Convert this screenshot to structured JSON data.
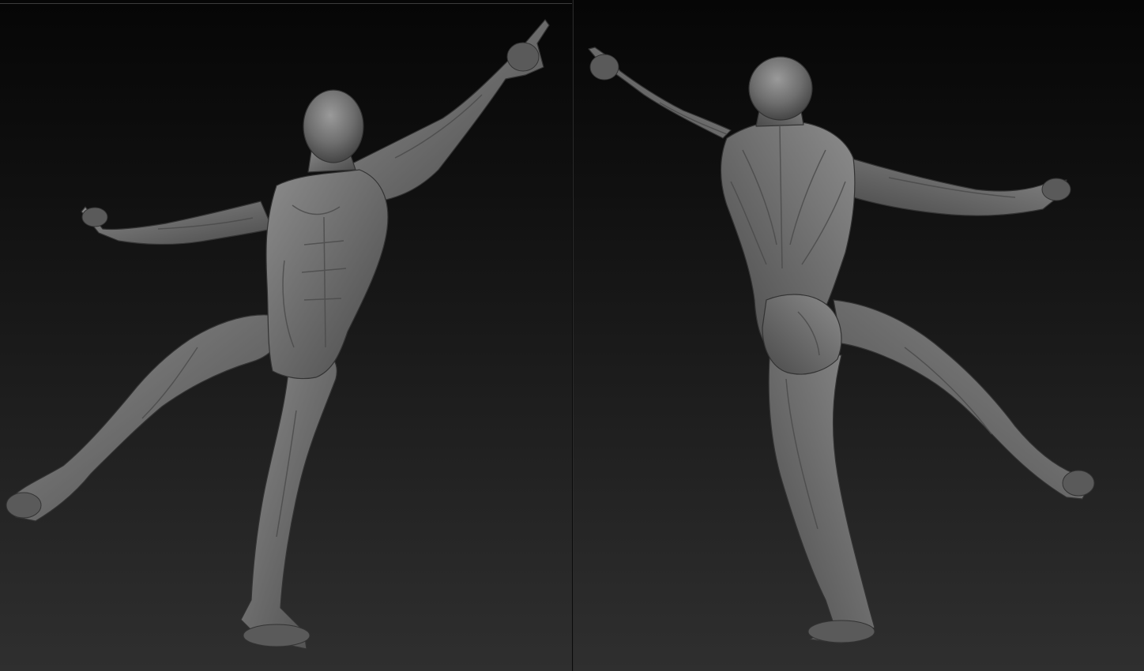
{
  "viewports": [
    {
      "view": "front",
      "figure": "clay-sculpt-figure-front"
    },
    {
      "view": "back",
      "figure": "clay-sculpt-figure-back"
    }
  ],
  "colors": {
    "background_top": "#060606",
    "background_bottom": "#2f2f2f",
    "clay": "#6e6e6e",
    "clay_highlight": "#9a9a9a",
    "clay_shadow": "#3e3e3e"
  }
}
